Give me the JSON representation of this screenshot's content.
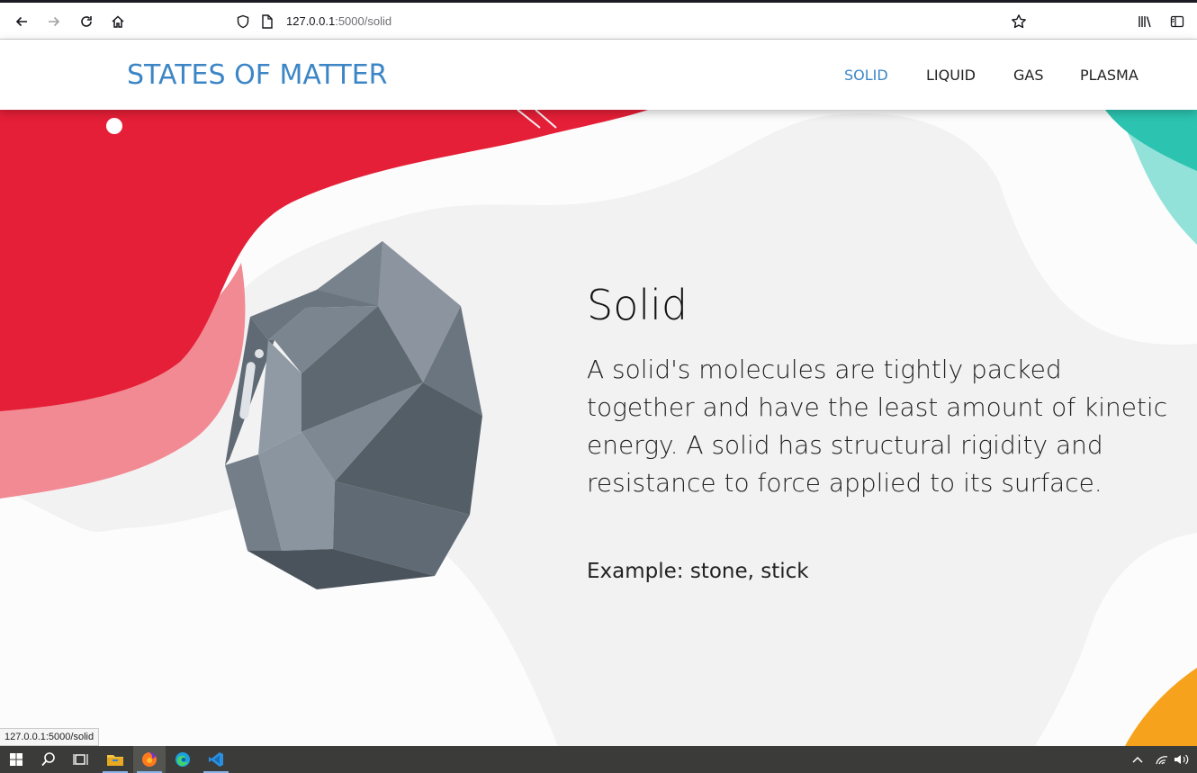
{
  "browser": {
    "url_host": "127.0.0.1",
    "url_path": ":5000/solid",
    "status_url": "127.0.0.1:5000/solid"
  },
  "site": {
    "logo": "STATES OF MATTER",
    "nav": [
      {
        "label": "SOLID",
        "active": true
      },
      {
        "label": "LIQUID",
        "active": false
      },
      {
        "label": "GAS",
        "active": false
      },
      {
        "label": "PLASMA",
        "active": false
      }
    ]
  },
  "main": {
    "title": "Solid",
    "description": "A solid's molecules are tightly packed together and have the least amount of kinetic energy. A solid has structural rigidity and resistance to force applied to its surface.",
    "example": "Example: stone, stick"
  },
  "colors": {
    "accent": "#3d86c6",
    "red_blob": "#e51f37",
    "pink_blob": "#f28a94",
    "teal_blob": "#2cc4b0",
    "orange_blob": "#f7a21c",
    "rock": "#6b7680"
  },
  "taskbar": {
    "icons": [
      "windows-start-icon",
      "search-icon",
      "task-view-icon",
      "file-explorer-icon",
      "firefox-icon",
      "edge-icon",
      "vscode-icon"
    ]
  }
}
